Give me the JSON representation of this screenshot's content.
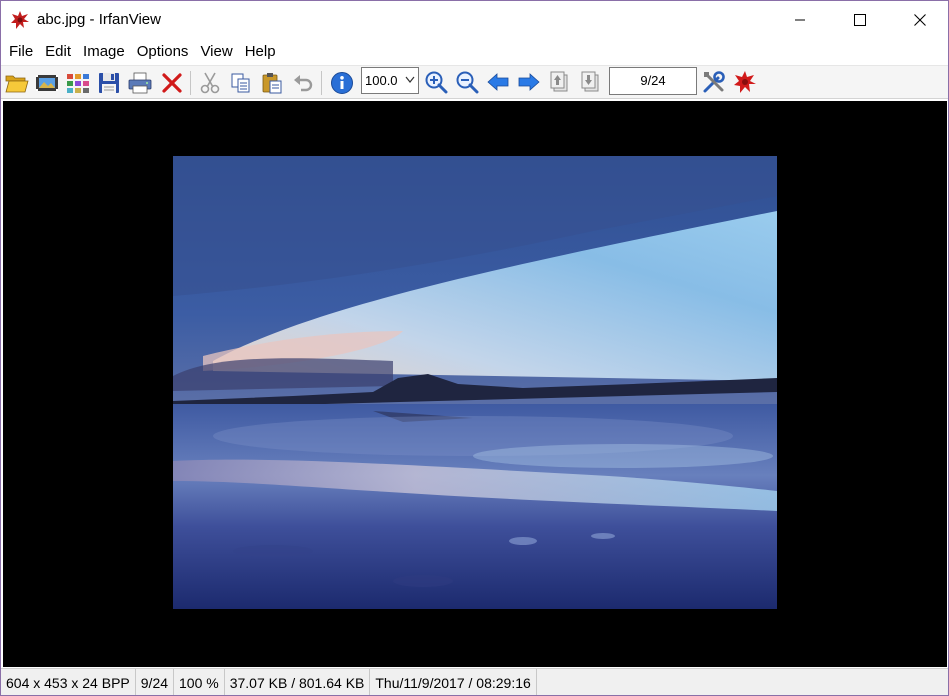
{
  "window": {
    "title": "abc.jpg - IrfanView"
  },
  "menu": {
    "items": [
      "File",
      "Edit",
      "Image",
      "Options",
      "View",
      "Help"
    ]
  },
  "toolbar": {
    "buttons": [
      {
        "icon": "open-folder-icon"
      },
      {
        "icon": "slideshow-icon"
      },
      {
        "icon": "thumbnails-icon"
      },
      {
        "icon": "save-icon"
      },
      {
        "icon": "print-icon"
      },
      {
        "icon": "delete-icon"
      },
      {
        "icon": "cut-icon"
      },
      {
        "icon": "copy-icon"
      },
      {
        "icon": "paste-icon"
      },
      {
        "icon": "undo-icon"
      },
      {
        "icon": "info-icon"
      },
      {
        "icon": "zoom-in-icon"
      },
      {
        "icon": "zoom-out-icon"
      },
      {
        "icon": "previous-icon"
      },
      {
        "icon": "next-icon"
      },
      {
        "icon": "first-page-icon"
      },
      {
        "icon": "last-page-icon"
      },
      {
        "icon": "properties-icon"
      },
      {
        "icon": "irfanview-icon"
      }
    ],
    "zoom_value": "100.0",
    "page_counter": "9/24"
  },
  "status": {
    "dimensions": "604 x 453 x 24 BPP",
    "index": "9/24",
    "zoom": "100 %",
    "size": "37.07 KB / 801.64 KB",
    "datetime": "Thu/11/9/2017 / 08:29:16"
  },
  "colors": {
    "viewer_background": "#000000",
    "toolbar_blue": "#2a6fd6",
    "delete_red": "#d11a1a"
  }
}
